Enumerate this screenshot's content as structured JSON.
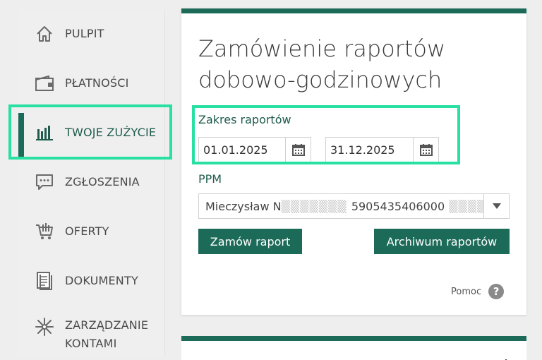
{
  "sidebar": {
    "items": [
      {
        "label": "PULPIT",
        "icon": "home-icon"
      },
      {
        "label": "PŁATNOŚCI",
        "icon": "wallet-icon"
      },
      {
        "label": "TWOJE ZUŻYCIE",
        "icon": "bar-chart-icon",
        "active": true
      },
      {
        "label": "ZGŁOSZENIA",
        "icon": "chat-bubble-icon"
      },
      {
        "label": "OFERTY",
        "icon": "shopping-cart-icon"
      },
      {
        "label": "DOKUMENTY",
        "icon": "documents-icon"
      },
      {
        "label": "ZARZĄDZANIE KONTAMI",
        "label_line1": "ZARZĄDZANIE",
        "label_line2": "KONTAMI",
        "icon": "asterisk-icon"
      }
    ]
  },
  "main": {
    "title_line1": "Zamówienie raportów",
    "title_line2": "dobowo-godzinowych",
    "range_label": "Zakres raportów",
    "date_from": "01.01.2025",
    "date_to": "31.12.2025",
    "ppm_label": "PPM",
    "ppm_value_name": "Mieczysław N",
    "ppm_value_number": "5905435406000",
    "ppm_value_tail": "7",
    "order_button": "Zamów raport",
    "archive_button": "Archiwum raportów",
    "help_label": "Pomoc",
    "help_icon_text": "?"
  },
  "colors": {
    "accent": "#1c6a58",
    "highlight": "#28e0a2",
    "text": "#4a4a4a"
  }
}
